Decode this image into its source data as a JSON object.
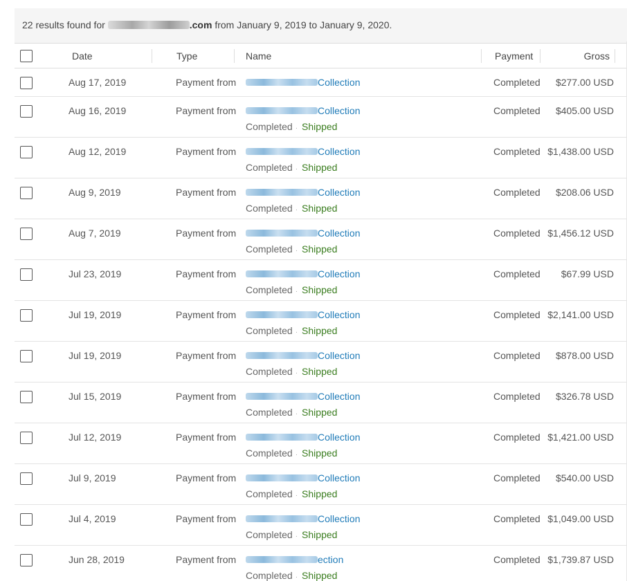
{
  "results": {
    "count_text": "22 results found for",
    "email_domain": ".com",
    "range_text": "from January 9, 2019 to January 9, 2020."
  },
  "columns": {
    "date": "Date",
    "type": "Type",
    "name": "Name",
    "payment": "Payment",
    "gross": "Gross"
  },
  "rows": [
    {
      "date": "Aug 17, 2019",
      "type": "Payment from",
      "name_suffix": "Collection",
      "status": "",
      "shipping": "",
      "payment": "Completed",
      "gross": "$277.00 USD"
    },
    {
      "date": "Aug 16, 2019",
      "type": "Payment from",
      "name_suffix": "Collection",
      "status": "Completed",
      "shipping": "Shipped",
      "payment": "Completed",
      "gross": "$405.00 USD"
    },
    {
      "date": "Aug 12, 2019",
      "type": "Payment from",
      "name_suffix": "Collection",
      "status": "Completed",
      "shipping": "Shipped",
      "payment": "Completed",
      "gross": "$1,438.00 USD"
    },
    {
      "date": "Aug 9, 2019",
      "type": "Payment from",
      "name_suffix": "Collection",
      "status": "Completed",
      "shipping": "Shipped",
      "payment": "Completed",
      "gross": "$208.06 USD"
    },
    {
      "date": "Aug 7, 2019",
      "type": "Payment from",
      "name_suffix": "Collection",
      "status": "Completed",
      "shipping": "Shipped",
      "payment": "Completed",
      "gross": "$1,456.12 USD"
    },
    {
      "date": "Jul 23, 2019",
      "type": "Payment from",
      "name_suffix": "Collection",
      "status": "Completed",
      "shipping": "Shipped",
      "payment": "Completed",
      "gross": "$67.99 USD"
    },
    {
      "date": "Jul 19, 2019",
      "type": "Payment from",
      "name_suffix": "Collection",
      "status": "Completed",
      "shipping": "Shipped",
      "payment": "Completed",
      "gross": "$2,141.00 USD"
    },
    {
      "date": "Jul 19, 2019",
      "type": "Payment from",
      "name_suffix": "Collection",
      "status": "Completed",
      "shipping": "Shipped",
      "payment": "Completed",
      "gross": "$878.00 USD"
    },
    {
      "date": "Jul 15, 2019",
      "type": "Payment from",
      "name_suffix": "Collection",
      "status": "Completed",
      "shipping": "Shipped",
      "payment": "Completed",
      "gross": "$326.78 USD"
    },
    {
      "date": "Jul 12, 2019",
      "type": "Payment from",
      "name_suffix": "Collection",
      "status": "Completed",
      "shipping": "Shipped",
      "payment": "Completed",
      "gross": "$1,421.00 USD"
    },
    {
      "date": "Jul 9, 2019",
      "type": "Payment from",
      "name_suffix": "Collection",
      "status": "Completed",
      "shipping": "Shipped",
      "payment": "Completed",
      "gross": "$540.00 USD"
    },
    {
      "date": "Jul 4, 2019",
      "type": "Payment from",
      "name_suffix": "Collection",
      "status": "Completed",
      "shipping": "Shipped",
      "payment": "Completed",
      "gross": "$1,049.00 USD"
    },
    {
      "date": "Jun 28, 2019",
      "type": "Payment from",
      "name_suffix": "ection",
      "status": "Completed",
      "shipping": "Shipped",
      "payment": "Completed",
      "gross": "$1,739.87 USD"
    }
  ]
}
